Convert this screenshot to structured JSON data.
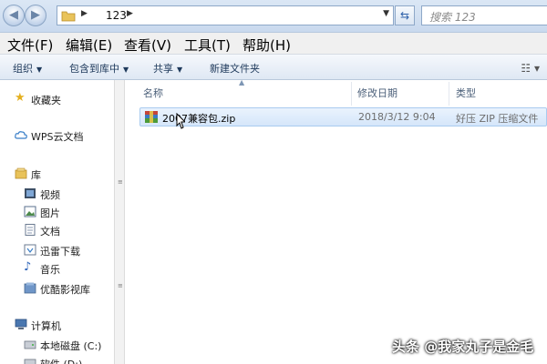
{
  "address_bar": {
    "path": "123",
    "search_placeholder": "搜索 123"
  },
  "menu": {
    "items": [
      "文件(F)",
      "编辑(E)",
      "查看(V)",
      "工具(T)",
      "帮助(H)"
    ]
  },
  "toolbar": {
    "organize": "组织",
    "include_in_library": "包含到库中",
    "share": "共享",
    "new_folder": "新建文件夹"
  },
  "nav": {
    "favorites": "收藏夹",
    "wps_cloud": "WPS云文档",
    "libraries": "库",
    "videos": "视频",
    "pictures": "图片",
    "documents": "文档",
    "thunder_downloads": "迅雷下载",
    "music": "音乐",
    "youku": "优酷影视库",
    "computer": "计算机",
    "local_disk_c": "本地磁盘 (C:)",
    "software_d": "软件 (D:)"
  },
  "columns": {
    "name": "名称",
    "modified": "修改日期",
    "type": "类型"
  },
  "files": [
    {
      "name": "2007兼容包.zip",
      "modified": "2018/3/12 9:04",
      "type": "好压 ZIP 压缩文件"
    }
  ],
  "watermark": "头条 @我家丸子是金毛",
  "colors": {
    "selection": "#d5e6fa",
    "selection_border": "#a9cbef",
    "toolbar_text": "#1e395b"
  }
}
